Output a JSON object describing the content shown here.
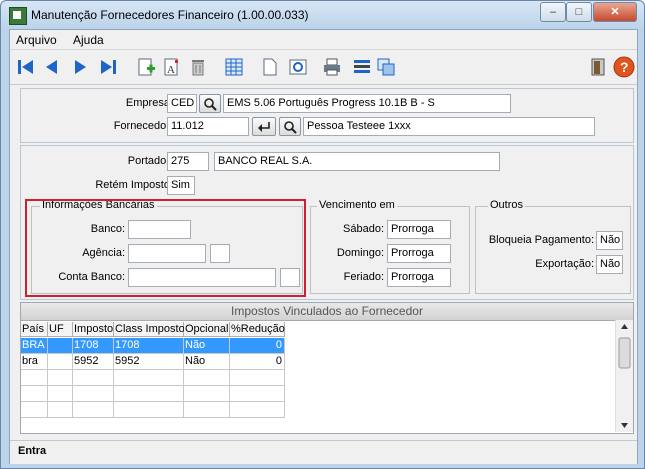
{
  "window": {
    "title": "Manutenção Fornecedores Financeiro (1.00.00.033)",
    "btn_minimize": "–",
    "btn_maximize": "□",
    "btn_close": "✕"
  },
  "menu": [
    "Arquivo",
    "Ajuda"
  ],
  "toolbar": {
    "icons": [
      "first-icon",
      "prev-icon",
      "next-icon",
      "last-icon",
      "add-icon",
      "edit-text-icon",
      "delete-icon",
      "grid-icon",
      "document-icon",
      "preview-icon",
      "print-icon",
      "list-icon",
      "copy-icon",
      "exit-door-icon",
      "help-icon"
    ]
  },
  "empresa": {
    "label": "Empresa:",
    "code": "CED",
    "desc": "EMS 5.06 Português Progress 10.1B B - S"
  },
  "fornecedor": {
    "label": "Fornecedor:",
    "code": "11.012",
    "desc": "Pessoa Testeee 1xxx"
  },
  "portador": {
    "label": "Portador:",
    "code": "275",
    "desc": "BANCO REAL S.A."
  },
  "retem": {
    "label": "Retém Imposto:",
    "value": "Sim"
  },
  "bancarias": {
    "legend": "Informações Bancárias",
    "banco_label": "Banco:",
    "banco": "",
    "agencia_label": "Agência:",
    "agencia": "",
    "agencia_dv": "",
    "conta_label": "Conta Banco:",
    "conta": "",
    "conta_dv": ""
  },
  "vencimento": {
    "legend": "Vencimento em",
    "sabado_label": "Sábado:",
    "sabado": "Prorroga",
    "domingo_label": "Domingo:",
    "domingo": "Prorroga",
    "feriado_label": "Feriado:",
    "feriado": "Prorroga"
  },
  "outros": {
    "legend": "Outros",
    "bloqueia_label": "Bloqueia Pagamento:",
    "bloqueia": "Não",
    "exportacao_label": "Exportação:",
    "exportacao": "Não"
  },
  "impostos": {
    "caption": "Impostos Vinculados ao Fornecedor",
    "columns": [
      "País",
      "UF",
      "Imposto",
      "Class Imposto",
      "Opcional",
      "%Redução"
    ],
    "rows": [
      [
        "BRA",
        "",
        "1708",
        "1708",
        "Não",
        "0"
      ],
      [
        "bra",
        "",
        "5952",
        "5952",
        "Não",
        "0"
      ]
    ]
  },
  "status": "Entra",
  "colors": {
    "accent_red": "#d21f2e",
    "selection": "#3399ff",
    "toolbar_blue": "#1f64c8"
  }
}
